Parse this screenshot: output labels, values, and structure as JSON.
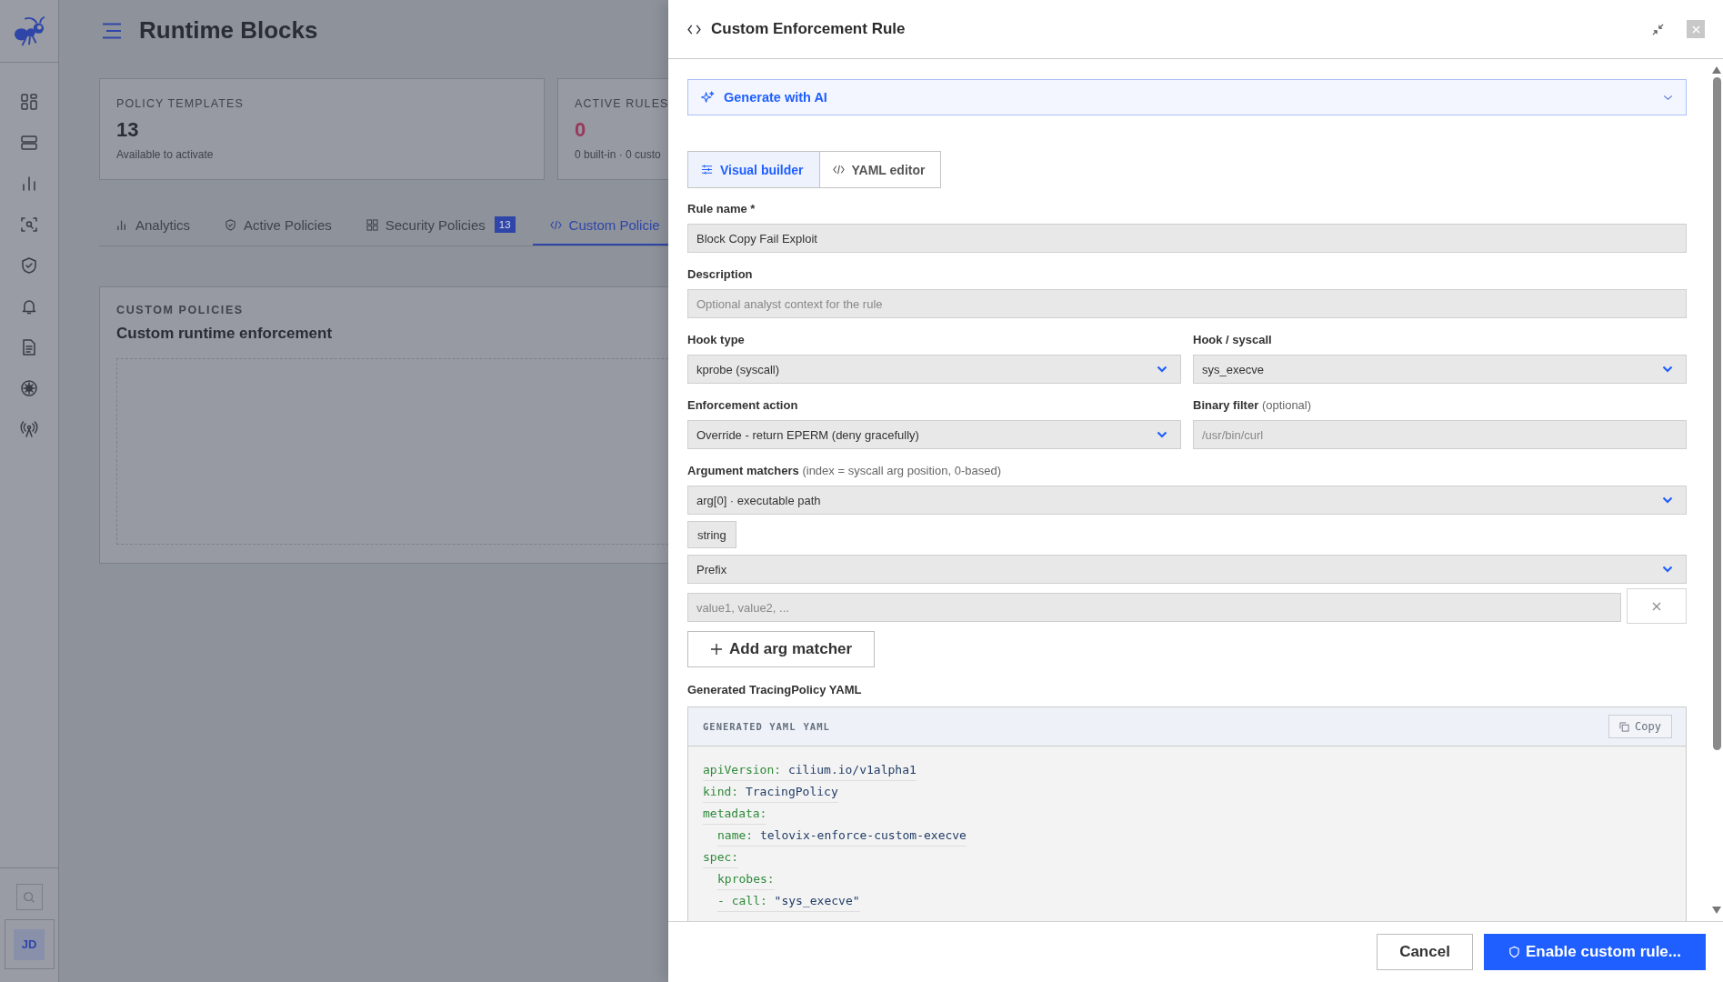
{
  "sidebar": {
    "avatar": "JD"
  },
  "page": {
    "title": "Runtime Blocks",
    "stats": [
      {
        "label": "POLICY TEMPLATES",
        "value": "13",
        "note": "Available to activate",
        "color": "#2a2d33"
      },
      {
        "label": "ACTIVE RULES",
        "value": "0",
        "note": "0 built-in · 0 custo",
        "color": "#98385a"
      }
    ],
    "tabs": [
      {
        "label": "Analytics",
        "selected": false
      },
      {
        "label": "Active Policies",
        "selected": false
      },
      {
        "label": "Security Policies",
        "badge": "13",
        "selected": false
      },
      {
        "label": "Custom Policie",
        "selected": true
      }
    ],
    "section": {
      "eyebrow": "CUSTOM POLICIES",
      "title": "Custom runtime enforcement"
    }
  },
  "panel": {
    "title": "Custom Enforcement Rule",
    "ai": {
      "label": "Generate with AI",
      "expanded": false
    },
    "modes": [
      {
        "label": "Visual builder",
        "selected": true
      },
      {
        "label": "YAML editor",
        "selected": false
      }
    ],
    "rows": [
      [
        {
          "kind": "text",
          "label": "Rule name *",
          "value": "Block Copy Fail Exploit"
        }
      ],
      [
        {
          "kind": "text",
          "label": "Description",
          "placeholder": "Optional analyst context for the rule"
        }
      ],
      [
        {
          "kind": "select",
          "label": "Hook type",
          "value": "kprobe (syscall)"
        },
        {
          "kind": "select",
          "label": "Hook / syscall",
          "value": "sys_execve"
        }
      ],
      [
        {
          "kind": "select",
          "label": "Enforcement action",
          "value": "Override - return EPERM (deny gracefully)"
        },
        {
          "kind": "text",
          "label": "Binary filter",
          "hint": "(optional)",
          "placeholder": "/usr/bin/curl"
        }
      ]
    ],
    "matchers": {
      "label": "Argument matchers",
      "hint": "(index = syscall arg position, 0-based)",
      "arg": "arg[0] · executable path",
      "type": "string",
      "operator": "Prefix",
      "values_placeholder": "value1, value2, ..."
    },
    "add_button": "Add arg matcher",
    "yaml": {
      "label": "Generated TracingPolicy YAML",
      "header": "GENERATED YAML",
      "lang": "YAML",
      "copy": "Copy",
      "lines": [
        {
          "key": "apiVersion:",
          "value": "cilium.io/v1alpha1"
        },
        {
          "key": "kind:",
          "value": "TracingPolicy"
        },
        {
          "key": "metadata:",
          "children": [
            {
              "key": "name:",
              "value": "telovix-enforce-custom-execve"
            }
          ]
        },
        {
          "key": "spec:",
          "children": [
            {
              "key": "kprobes:"
            },
            {
              "key": "- call:",
              "value": "\"sys_execve\""
            }
          ]
        }
      ]
    },
    "cancel": "Cancel",
    "confirm": "Enable custom rule..."
  }
}
